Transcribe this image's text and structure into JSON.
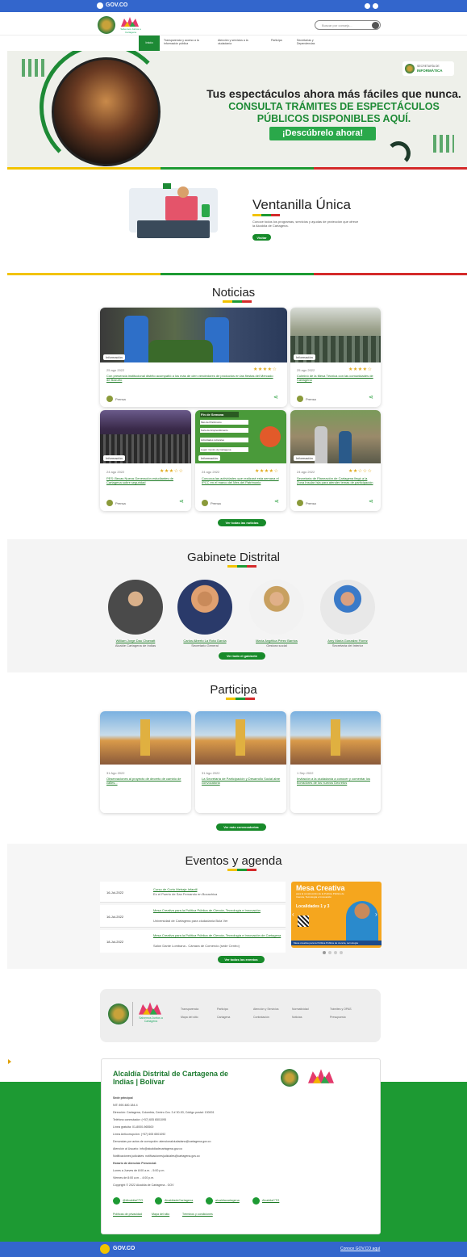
{
  "topbar": {
    "brand": "GOV.CO"
  },
  "header": {
    "logo_text": "Salvemos Juntos a Cartagena",
    "search_placeholder": "Buscar por consejo...",
    "nav": [
      "Inicio",
      "Transparencia y acceso a la información pública",
      "Atención y servicios a la ciudadanía",
      "Participa",
      "Secretarías y Dependencias"
    ]
  },
  "hero": {
    "tag_line1": "SECRETARÍA DE",
    "tag_line2": "INFORMÁTICA",
    "line1": "Tus espectáculos ahora más fáciles que nunca.",
    "line2": "CONSULTA TRÁMITES DE ESPECTÁCULOS",
    "line3": "PÚBLICOS DISPONIBLES AQUÍ.",
    "cta": "¡Descúbrelo ahora!"
  },
  "ventanilla": {
    "title": "Ventanilla Única",
    "desc": "Conoce todos los programas, servicios y ayudas de protección que ofrece la Alcaldía de Cartagena.",
    "button": "Visitar"
  },
  "noticias": {
    "title": "Noticias",
    "more": "Ver todas las noticias",
    "cards": [
      {
        "tag": "Información",
        "date": "25 ago 2022",
        "title": "Con presencia institucional distrito acompañó a los más de cien vendedores de productos en las fiestas del Mercado de Bazurto",
        "author": "Prensa"
      },
      {
        "tag": "Información",
        "date": "25 ago 2022",
        "title": "Culminó de la Mesa Técnica con las comunidades de Cartagena",
        "author": "Prensa"
      },
      {
        "tag": "Información",
        "date": "24 ago 2022",
        "title": "PES: Becas Nueva Generación estudiantes de Cartagena sobre seguridad",
        "author": "Prensa"
      },
      {
        "tag": "Información",
        "date": "24 ago 2022",
        "title": "Conozca las actividades que realizará esta semana el IPCC en el marco del Mes del Patrimonio",
        "author": "Prensa"
      },
      {
        "tag": "Información",
        "date": "24 ago 2022",
        "title": "Secretaría de Planeación de Cartagena llegó a la Zona Insular Isla para atender temas de participación",
        "author": "Prensa"
      }
    ],
    "flyer": {
      "title": "Fin de Semana",
      "item1": "Mes del Patrimonio",
      "item2": "Feria de Emprendimiento",
      "item3": "Actividades culturales",
      "item4": "Lugar: Centro de Cartagena"
    }
  },
  "gabinete": {
    "title": "Gabinete Distrital",
    "more": "Ver todo el gabinete",
    "people": [
      {
        "name": "William Jorge Dau Chamatt",
        "role": "Alcalde Cartagena de Indias"
      },
      {
        "name": "Carlos Alberto La Rota Garcia",
        "role": "Secretario General"
      },
      {
        "name": "María Angélica Pérez Barrios",
        "role": "Gestora social"
      },
      {
        "name": "Amy María Gonzalez Florez",
        "role": "Secretaria del Interior"
      }
    ]
  },
  "participa": {
    "title": "Participa",
    "more": "Ver más convocatorias",
    "cards": [
      {
        "date": "31 Ago 2022",
        "title": "Observaciones al proyecto de decreto de cambio de calles..."
      },
      {
        "date": "31 Ago 2022",
        "title": "La Secretaría de Participación y Desarrollo Social abre convocatoria"
      },
      {
        "date": "1 Sep 2022",
        "title": "Invitación a la ciudadanía a conocer y comentar los borradores de los nuevos Decretos"
      }
    ]
  },
  "eventos": {
    "title": "Eventos y agenda",
    "more": "Ver todos los eventos",
    "items": [
      {
        "date": "16-Jul-2022",
        "title": "Curso de Corto Metraje Infantil",
        "place": "En el Puerto de San Fernando en Bocachica"
      },
      {
        "date": "16-Jul-2022",
        "title": "Mesa Creativa para la Política Pública de Ciencia, Tecnología e Innovación",
        "place": "Universidad de Cartagena para ciudadanía Bula Ver"
      },
      {
        "date": "18-Jul-2022",
        "title": "Mesa Creativa para la Política Pública de Ciencia, Tecnología e Innovación de Cartagena",
        "place": "Salón Dante Lombana - Cámara de Comercio (sede Centro)"
      }
    ],
    "banner": {
      "title": "Mesa Creativa",
      "sub": "para la construcción de la Política Pública de Ciencia, Tecnología e Innovación",
      "localidades": "Localidades 1 y 3",
      "footer": "Mesa creativa para la Política Pública de ciencia, tecnología"
    }
  },
  "footer_links": {
    "logo_text": "Salvemos Juntos a Cartagena",
    "links": [
      "Transparencia",
      "Participa",
      "Atención y Servicios",
      "Normatividad",
      "Trámites y OPAS",
      "Mapa del sitio",
      "Cartagena",
      "Contratación",
      "Noticias",
      "Presupuesto"
    ]
  },
  "contact": {
    "title_line1": "Alcaldía Distrital de Cartagena de",
    "title_line2": "Indias | Bolívar",
    "lines": [
      "Sede principal",
      "NIT: 890.480.184-4",
      "Dirección: Cartagena, Colombia, Centro Cra. 3 # 30-53, Código postal: 130001",
      "Teléfono conmutador: (+57) 605 6501095",
      "Línea gratuita: 01-8000-965500",
      "Línea Anticorrupción: (+57) 605 6501092",
      "Denuncias por actos de corrupción: atencionalciudadano@cartagena.gov.co",
      "Atención al Usuario: info@alcaldiadecartagena.gov.co",
      "Notificaciones judiciales: notificacionesjudiciales@cartagena.gov.co",
      "Horario de Atención Presencial:",
      "Lunes a Jueves de 8:00 a.m. - 5:00 p.m.",
      "Viernes de 8:00 a.m. - 4:00 p.m.",
      "Copyright © 2022 Alcaldía de Cartagena - GOV"
    ],
    "social": [
      "@AlcaldiaCTG",
      "AlcaldiadeCartagena",
      "alcaldiacartagena",
      "AlcaldiaCTG"
    ],
    "policies": [
      "Políticas de privacidad",
      "Mapa del sitio",
      "Términos y condiciones"
    ]
  },
  "bottombar": {
    "brand": "GOV.CO",
    "link": "Conoce GOV.CO aquí"
  }
}
